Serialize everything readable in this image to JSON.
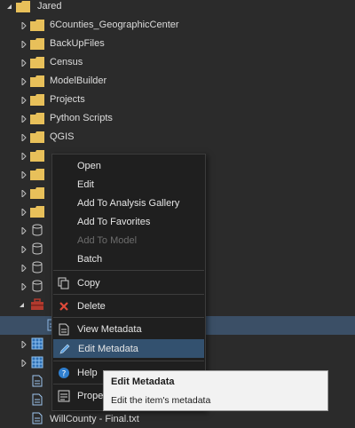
{
  "tree": {
    "root_label": "Jared",
    "folders": [
      "6Counties_GeographicCenter",
      "BackUpFiles",
      "Census",
      "ModelBuilder",
      "Projects",
      "Python Scripts",
      "QGIS"
    ],
    "bottom_file": "WillCounty - Final.txt"
  },
  "context_menu": {
    "open": "Open",
    "edit": "Edit",
    "add_analysis": "Add To Analysis Gallery",
    "add_favorites": "Add To Favorites",
    "add_model": "Add To Model",
    "batch": "Batch",
    "copy": "Copy",
    "delete": "Delete",
    "view_metadata": "View Metadata",
    "edit_metadata": "Edit Metadata",
    "help": "Help",
    "properties": "Prope"
  },
  "tooltip": {
    "title": "Edit Metadata",
    "description": "Edit the item's metadata"
  },
  "colors": {
    "background": "#2b2b2b",
    "folder": "#e8c05a",
    "selection": "#3b4f66",
    "menu_highlight": "#33516f",
    "delete_x": "#e04a3a"
  }
}
